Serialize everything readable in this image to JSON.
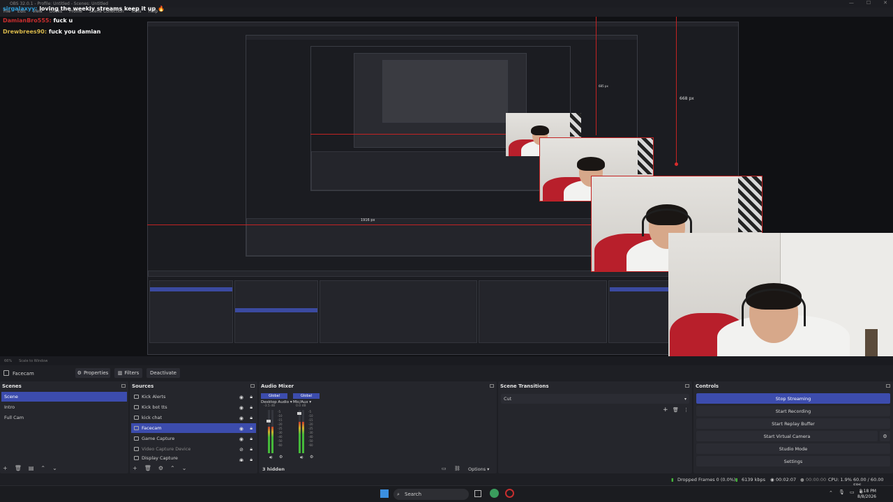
{
  "window": {
    "title": "OBS 32.0.1 - Profile: Untitled - Scenes: Untitled",
    "menu": [
      "File",
      "Edit",
      "View",
      "Docks",
      "Profile",
      "Scene Collection",
      "Tools",
      "Help"
    ]
  },
  "chat": [
    {
      "user": "sirgalaxyy:",
      "msg": "loving the weekly streams keep it up 🔥"
    },
    {
      "user": "DamianBro555:",
      "msg": "fuck u"
    },
    {
      "user": "Drewbrees90:",
      "msg": "fuck you damian"
    }
  ],
  "preview": {
    "measure_top": "668 px",
    "measure_mid": "685 px",
    "measure_small": "1916 px",
    "zoom": "66%",
    "scale_mode": "Scale to Window"
  },
  "source_toolbar": {
    "selected_source": "Facecam",
    "properties": "Properties",
    "filters": "Filters",
    "deactivate": "Deactivate"
  },
  "scenes": {
    "title": "Scenes",
    "items": [
      "Scene",
      "Intro",
      "Full Cam"
    ],
    "selected": 0
  },
  "sources": {
    "title": "Sources",
    "items": [
      "Kick Alerts",
      "Kick bot tts",
      "kick chat",
      "Facecam",
      "Game Capture",
      "Video Capture Device",
      "Display Capture"
    ],
    "selected": 3
  },
  "mixer": {
    "title": "Audio Mixer",
    "channels": [
      {
        "tag": "Global",
        "name": "Desktop Audio",
        "db": "-3.5 dB",
        "level": 0.62,
        "fader": 0.78
      },
      {
        "tag": "Global",
        "name": "Mic/Aux",
        "db": "0.0 dB",
        "level": 0.72,
        "fader": 0.95
      }
    ],
    "hidden": "3 hidden",
    "options": "Options"
  },
  "transitions": {
    "title": "Scene Transitions",
    "selected": "Cut"
  },
  "controls": {
    "title": "Controls",
    "buttons": [
      "Stop Streaming",
      "Start Recording",
      "Start Replay Buffer",
      "Start Virtual Camera",
      "Studio Mode",
      "Settings"
    ]
  },
  "status": {
    "dropped": "Dropped Frames 0 (0.0%)",
    "bitrate": "6139 kbps",
    "stream_time": "00:02:07",
    "rec_time": "00:00:00",
    "cpu": "CPU: 1.9%",
    "fps": "60.00 / 60.00 FPS"
  },
  "taskbar": {
    "search": "Search",
    "time": "8:18 PM",
    "date": "8/8/2026"
  },
  "colors": {
    "accent": "#3c4cad",
    "guide_red": "#c32323",
    "panel": "#25262c",
    "bg": "#1e1f24"
  }
}
